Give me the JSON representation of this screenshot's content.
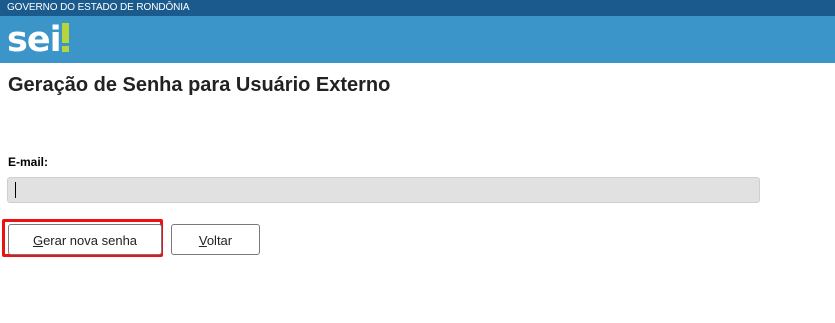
{
  "header": {
    "government": "GOVERNO DO ESTADO DE RONDÔNIA",
    "logo_text": "sei",
    "top_bar_color": "#1b5a8c",
    "brand_bar_color": "#3b95c8"
  },
  "page": {
    "title": "Geração de Senha para Usuário Externo"
  },
  "form": {
    "email_label": "E-mail:",
    "email_value": "",
    "email_placeholder": ""
  },
  "buttons": {
    "generate": {
      "first": "G",
      "rest": "erar nova senha"
    },
    "back": {
      "first": "V",
      "rest": "oltar"
    }
  },
  "highlight_color": "#ee1111"
}
